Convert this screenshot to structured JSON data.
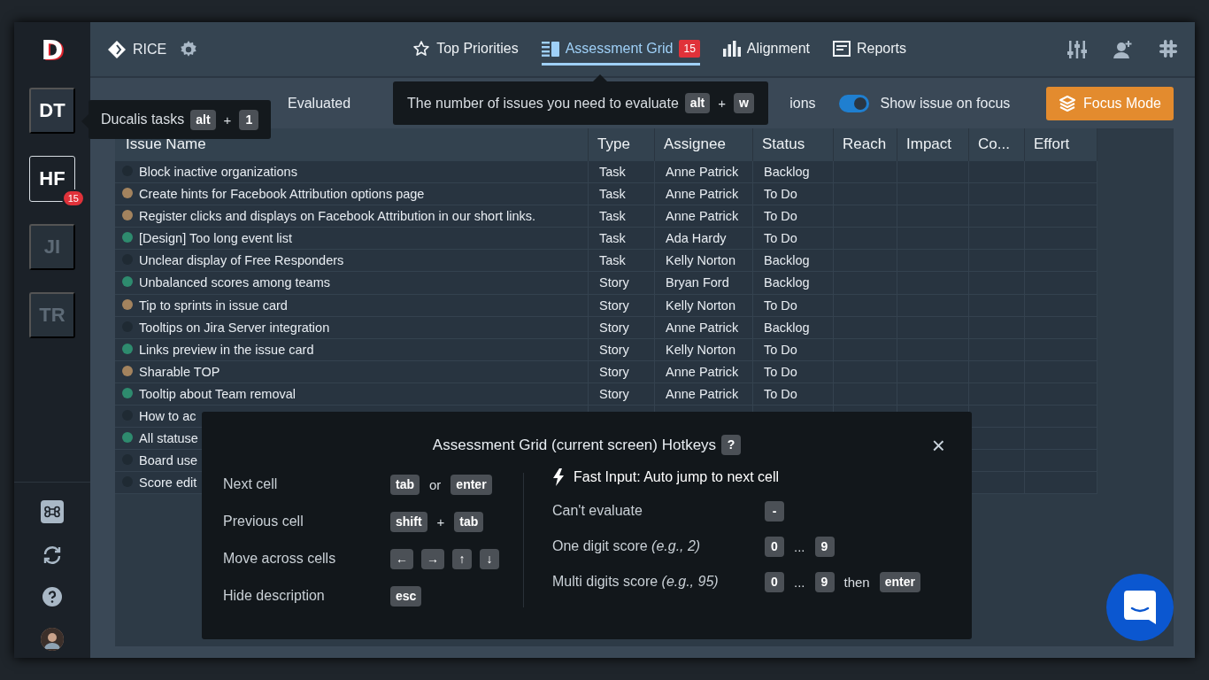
{
  "sidebar": {
    "logo": "D",
    "workspaces": [
      {
        "label": "DT",
        "selected": false,
        "hovered": true
      },
      {
        "label": "HF",
        "selected": true,
        "hovered": false,
        "badge": "15"
      },
      {
        "label": "JI",
        "selected": false,
        "hovered": false
      },
      {
        "label": "TR",
        "selected": false,
        "hovered": false
      }
    ]
  },
  "header": {
    "project": "RICE",
    "tabs": [
      {
        "label": "Top Priorities",
        "kind": "star",
        "selected": false
      },
      {
        "label": "Assessment Grid",
        "kind": "grid",
        "selected": true,
        "badge": "15"
      },
      {
        "label": "Alignment",
        "kind": "bars",
        "selected": false
      },
      {
        "label": "Reports",
        "kind": "report",
        "selected": false
      }
    ]
  },
  "filter_text": "Evaluated",
  "options_text": "ions",
  "show_on_focus": {
    "label": "Show issue on focus",
    "on": true
  },
  "focus_button": "Focus Mode",
  "table": {
    "columns": [
      "Issue Name",
      "Type",
      "Assignee",
      "Status",
      "Reach",
      "Impact",
      "Co...",
      "Effort"
    ],
    "rows": [
      {
        "color": "#1f2a33",
        "name": "Block inactive organizations",
        "type": "Task",
        "assignee": "Anne Patrick",
        "status": "Backlog"
      },
      {
        "color": "#a3835e",
        "name": "Create hints for Facebook Attribution options page",
        "type": "Task",
        "assignee": "Anne Patrick",
        "status": "To Do"
      },
      {
        "color": "#a3835e",
        "name": "Register clicks and displays on Facebook Attribution in our short links.",
        "type": "Task",
        "assignee": "Anne Patrick",
        "status": "To Do"
      },
      {
        "color": "#2e8b6e",
        "name": "[Design] Too long event list",
        "type": "Task",
        "assignee": "Ada Hardy",
        "status": "To Do"
      },
      {
        "color": "#1f2a33",
        "name": "Unclear display of Free Responders",
        "type": "Task",
        "assignee": "Kelly Norton",
        "status": "Backlog"
      },
      {
        "color": "#2e8b6e",
        "name": "Unbalanced scores among teams",
        "type": "Story",
        "assignee": "Bryan Ford",
        "status": "Backlog"
      },
      {
        "color": "#a3835e",
        "name": "Tip to sprints in issue card",
        "type": "Story",
        "assignee": "Kelly Norton",
        "status": "To Do"
      },
      {
        "color": "#1f2a33",
        "name": "Tooltips on Jira Server integration",
        "type": "Story",
        "assignee": "Anne Patrick",
        "status": "Backlog"
      },
      {
        "color": "#2e8b6e",
        "name": "Links preview in the issue card",
        "type": "Story",
        "assignee": "Kelly Norton",
        "status": "To Do"
      },
      {
        "color": "#a3835e",
        "name": "Sharable TOP",
        "type": "Story",
        "assignee": "Anne Patrick",
        "status": "To Do"
      },
      {
        "color": "#2e8b6e",
        "name": "Tooltip about Team removal",
        "type": "Story",
        "assignee": "Anne Patrick",
        "status": "To Do"
      },
      {
        "color": "#1f2a33",
        "name": "How to ac"
      },
      {
        "color": "#2e8b6e",
        "name": "All statuse"
      },
      {
        "color": "#1f2a33",
        "name": "Board use"
      },
      {
        "color": "#1f2a33",
        "name": "Score edit"
      }
    ]
  },
  "workspace_tooltip": {
    "text": "Ducalis tasks",
    "keys": [
      {
        "kind": "key",
        "text": "alt"
      },
      {
        "kind": "text",
        "text": "+"
      },
      {
        "kind": "key",
        "text": "1"
      }
    ]
  },
  "grid_tooltip": {
    "text": "The number of issues you need to evaluate",
    "keys": [
      {
        "kind": "key",
        "text": "alt"
      },
      {
        "kind": "text",
        "text": "+"
      },
      {
        "kind": "key",
        "text": "w"
      }
    ]
  },
  "hotkeys": {
    "title": "Assessment Grid (current screen) Hotkeys",
    "help_key": "?",
    "close": "×",
    "left": [
      {
        "label": "Next cell",
        "keys": [
          {
            "kind": "key",
            "text": "tab"
          },
          {
            "kind": "text",
            "text": "or"
          },
          {
            "kind": "key",
            "text": "enter"
          }
        ]
      },
      {
        "label": "Previous cell",
        "keys": [
          {
            "kind": "key",
            "text": "shift"
          },
          {
            "kind": "text",
            "text": "+"
          },
          {
            "kind": "key",
            "text": "tab"
          }
        ]
      },
      {
        "label": "Move across cells",
        "keys": [
          {
            "kind": "key",
            "text": "←"
          },
          {
            "kind": "key",
            "text": "→"
          },
          {
            "kind": "key",
            "text": "↑"
          },
          {
            "kind": "key",
            "text": "↓"
          }
        ]
      },
      {
        "label": "Hide description",
        "keys": [
          {
            "kind": "key",
            "text": "esc"
          }
        ]
      }
    ],
    "right_title": "Fast Input: Auto jump to next cell",
    "right": [
      {
        "label": "Can't evaluate",
        "keys": [
          {
            "kind": "key",
            "text": "-"
          }
        ]
      },
      {
        "label": "One digit score *(e.g., 2)*",
        "keys": [
          {
            "kind": "key",
            "text": "0"
          },
          {
            "kind": "text",
            "text": "..."
          },
          {
            "kind": "key",
            "text": "9"
          }
        ]
      },
      {
        "label": "Multi digits score *(e.g., 95)*",
        "keys": [
          {
            "kind": "key",
            "text": "0"
          },
          {
            "kind": "text",
            "text": "..."
          },
          {
            "kind": "key",
            "text": "9"
          },
          {
            "kind": "text",
            "text": "then"
          },
          {
            "kind": "key",
            "text": "enter"
          }
        ]
      }
    ]
  }
}
